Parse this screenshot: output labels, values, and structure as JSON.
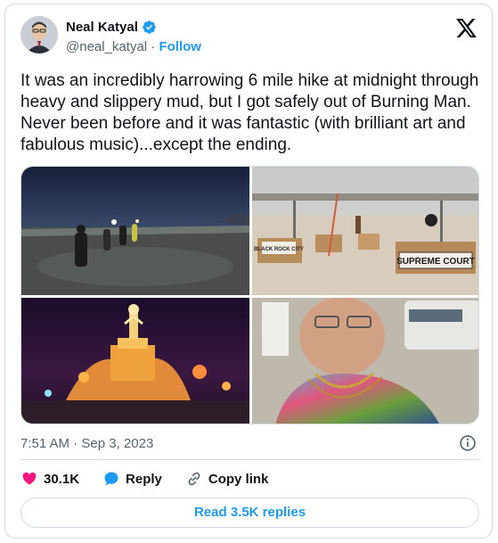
{
  "author": {
    "name": "Neal Katyal",
    "handle": "@neal_katyal",
    "separator": "·",
    "follow_label": "Follow"
  },
  "tweet": {
    "text": "It was an incredibly harrowing 6 mile hike at midnight through heavy and slippery mud, but I got safely out of Burning Man. Never been before and it was fantastic (with brilliant art and fabulous music)...except the ending."
  },
  "media": {
    "photo_2_signs": [
      "BLACK ROCK CITY",
      "SUPREME COURT"
    ]
  },
  "meta": {
    "time": "7:51 AM",
    "separator": "·",
    "date": "Sep 3, 2023"
  },
  "actions": {
    "likes": "30.1K",
    "reply_label": "Reply",
    "copy_link_label": "Copy link"
  },
  "read_replies_label": "Read 3.5K replies",
  "colors": {
    "accent": "#1d9bf0",
    "like": "#f91880",
    "text": "#0f1419",
    "muted": "#536471",
    "border": "#cfd9de"
  },
  "icons": [
    "verified-badge-icon",
    "x-logo-icon",
    "info-icon",
    "heart-icon",
    "reply-icon",
    "link-icon"
  ]
}
